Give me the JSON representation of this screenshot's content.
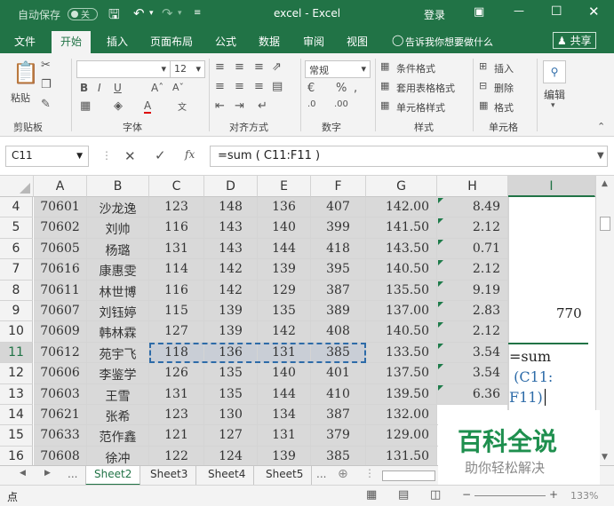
{
  "titlebar": {
    "autosave": "自动保存",
    "autosave_state": "关",
    "title": "excel  -  Excel",
    "login": "登录"
  },
  "ribbon": {
    "tabs": [
      "文件",
      "开始",
      "插入",
      "页面布局",
      "公式",
      "数据",
      "审阅",
      "视图"
    ],
    "active_tab": "开始",
    "tell_me": "告诉我你想要做什么",
    "share": "共享",
    "groups": {
      "clipboard": {
        "label": "剪贴板",
        "paste": "粘贴"
      },
      "font": {
        "label": "字体",
        "font_size": "12"
      },
      "alignment": {
        "label": "对齐方式"
      },
      "number": {
        "label": "数字",
        "format": "常规"
      },
      "styles": {
        "label": "样式",
        "conditional": "条件格式",
        "table": "套用表格格式",
        "cell_styles": "单元格样式"
      },
      "cells": {
        "label": "单元格",
        "insert": "插入",
        "delete": "删除",
        "format": "格式"
      },
      "editing": {
        "label": "编辑"
      }
    }
  },
  "formula_bar": {
    "name_box": "C11",
    "formula": "=sum ( C11:F11 )"
  },
  "grid": {
    "columns": [
      "A",
      "B",
      "C",
      "D",
      "E",
      "F",
      "G",
      "H",
      "I"
    ],
    "rows": [
      {
        "n": "4",
        "a": "70601",
        "b": "沙龙逸",
        "c": "123",
        "d": "148",
        "e": "136",
        "f": "407",
        "g": "142.00",
        "h": "8.49"
      },
      {
        "n": "5",
        "a": "70602",
        "b": "刘帅",
        "c": "116",
        "d": "143",
        "e": "140",
        "f": "399",
        "g": "141.50",
        "h": "2.12"
      },
      {
        "n": "6",
        "a": "70605",
        "b": "杨璐",
        "c": "131",
        "d": "143",
        "e": "144",
        "f": "418",
        "g": "143.50",
        "h": "0.71"
      },
      {
        "n": "7",
        "a": "70616",
        "b": "康惠雯",
        "c": "114",
        "d": "142",
        "e": "139",
        "f": "395",
        "g": "140.50",
        "h": "2.12"
      },
      {
        "n": "8",
        "a": "70611",
        "b": "林世博",
        "c": "116",
        "d": "142",
        "e": "129",
        "f": "387",
        "g": "135.50",
        "h": "9.19"
      },
      {
        "n": "9",
        "a": "70607",
        "b": "刘钰婷",
        "c": "115",
        "d": "139",
        "e": "135",
        "f": "389",
        "g": "137.00",
        "h": "2.83"
      },
      {
        "n": "10",
        "a": "70609",
        "b": "韩林霖",
        "c": "127",
        "d": "139",
        "e": "142",
        "f": "408",
        "g": "140.50",
        "h": "2.12"
      },
      {
        "n": "11",
        "a": "70612",
        "b": "苑宇飞",
        "c": "118",
        "d": "136",
        "e": "131",
        "f": "385",
        "g": "133.50",
        "h": "3.54"
      },
      {
        "n": "12",
        "a": "70606",
        "b": "李鉴学",
        "c": "126",
        "d": "135",
        "e": "140",
        "f": "401",
        "g": "137.50",
        "h": "3.54"
      },
      {
        "n": "13",
        "a": "70603",
        "b": "王雪",
        "c": "131",
        "d": "135",
        "e": "144",
        "f": "410",
        "g": "139.50",
        "h": "6.36"
      },
      {
        "n": "14",
        "a": "70621",
        "b": "张希",
        "c": "123",
        "d": "130",
        "e": "134",
        "f": "387",
        "g": "132.00",
        "h": ""
      },
      {
        "n": "15",
        "a": "70633",
        "b": "范作鑫",
        "c": "121",
        "d": "127",
        "e": "131",
        "f": "379",
        "g": "129.00",
        "h": ""
      },
      {
        "n": "16",
        "a": "70608",
        "b": "徐冲",
        "c": "122",
        "d": "124",
        "e": "139",
        "f": "385",
        "g": "131.50",
        "h": ""
      }
    ],
    "i9_value": "770",
    "i11_editing": [
      "=sum",
      " (C11:",
      "F11)"
    ]
  },
  "sheet_tabs": [
    "Sheet2",
    "Sheet3",
    "Sheet4",
    "Sheet5"
  ],
  "active_sheet": "Sheet2",
  "sheet_more": "...",
  "status": {
    "mode": "点",
    "zoom": "133%"
  },
  "watermark": {
    "title": "百科全说",
    "subtitle": "助你轻松解决"
  }
}
